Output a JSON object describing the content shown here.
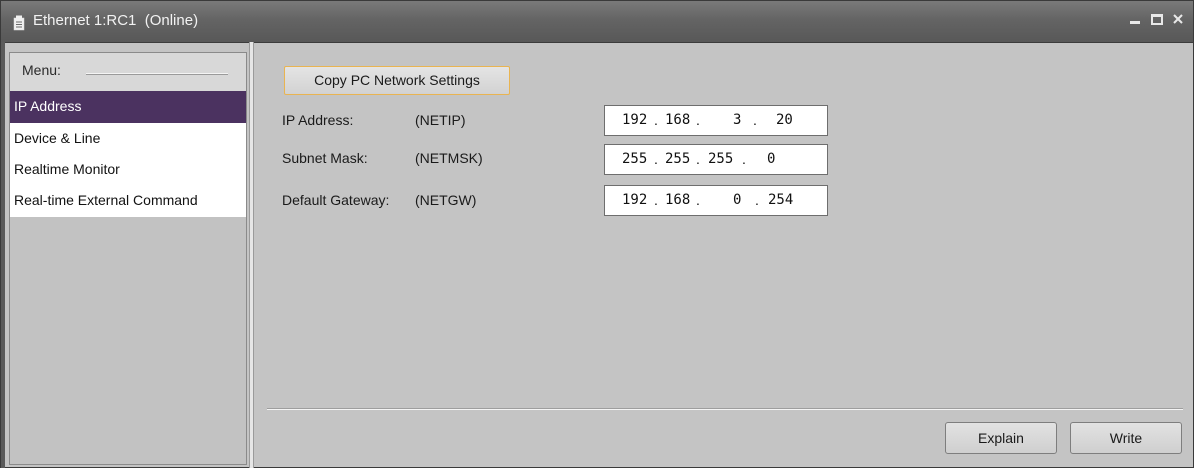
{
  "window": {
    "title": "Ethernet 1:RC1  (Online)",
    "icon": "document-icon",
    "controls": {
      "minimize_icon": "minimize-icon",
      "maximize_icon": "maximize-icon",
      "close_icon": "close-icon"
    }
  },
  "menu": {
    "header": "Menu:",
    "items": [
      {
        "label": "IP Address",
        "selected": true
      },
      {
        "label": "Device & Line",
        "selected": false
      },
      {
        "label": "Realtime Monitor",
        "selected": false
      },
      {
        "label": "Real-time External Command",
        "selected": false
      }
    ],
    "selected_color": "#4b3260"
  },
  "content": {
    "copy_button": "Copy PC Network Settings",
    "rows": [
      {
        "label": "IP Address:",
        "code": "(NETIP)",
        "octets": [
          "192",
          "168",
          "3",
          "20"
        ]
      },
      {
        "label": "Subnet Mask:",
        "code": "(NETMSK)",
        "octets": [
          "255",
          "255",
          "255",
          "0"
        ]
      },
      {
        "label": "Default Gateway:",
        "code": "(NETGW)",
        "octets": [
          "192",
          "168",
          "0",
          "254"
        ]
      }
    ],
    "explain_button": "Explain",
    "write_button": "Write",
    "focus_accent": "#e9b451"
  }
}
